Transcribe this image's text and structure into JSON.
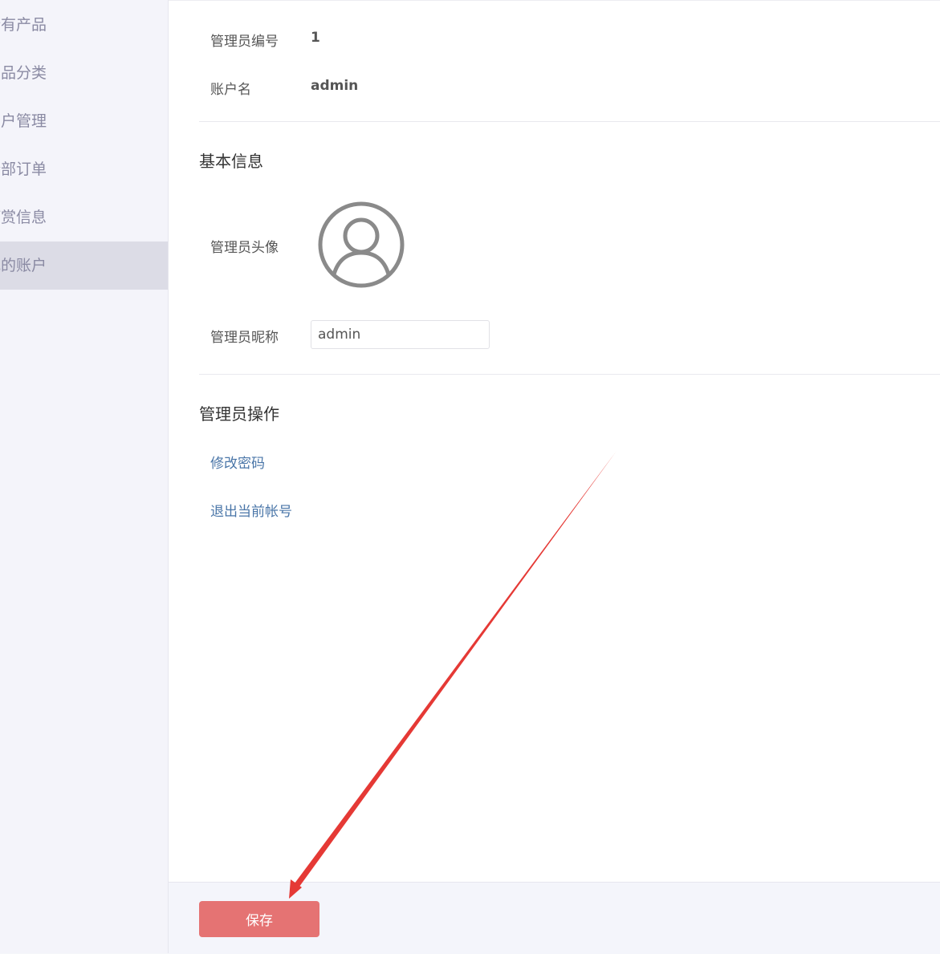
{
  "sidebar": {
    "items": [
      {
        "label": "所有产品"
      },
      {
        "label": "产品分类"
      },
      {
        "label": "用户管理"
      },
      {
        "label": "全部订单"
      },
      {
        "label": "打赏信息"
      },
      {
        "label": "我的账户"
      }
    ],
    "active_index": 5
  },
  "account": {
    "id_label": "管理员编号",
    "id_value": "1",
    "username_label": "账户名",
    "username_value": "admin"
  },
  "basic_info": {
    "title": "基本信息",
    "avatar_label": "管理员头像",
    "nickname_label": "管理员昵称",
    "nickname_value": "admin"
  },
  "operations": {
    "title": "管理员操作",
    "change_password": "修改密码",
    "logout": "退出当前帐号"
  },
  "footer": {
    "save_label": "保存"
  },
  "colors": {
    "save_button": "#e57373",
    "link": "#4a76a8",
    "active_sidebar": "#dcdce6",
    "annotation_arrow": "#e53935"
  }
}
